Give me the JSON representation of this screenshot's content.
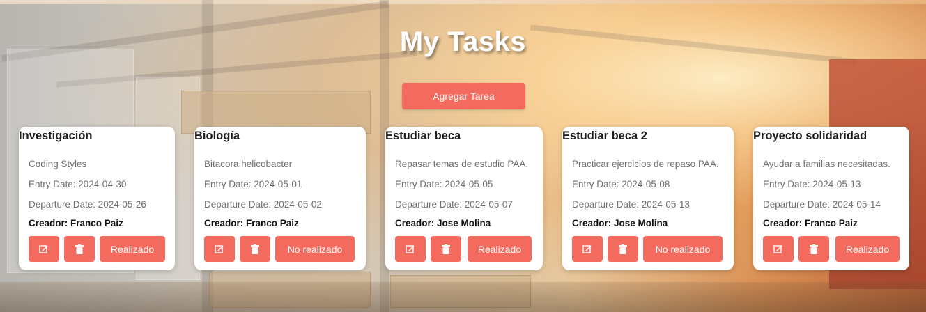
{
  "page": {
    "title": "My Tasks",
    "add_button_label": "Agregar Tarea"
  },
  "colors": {
    "accent": "#f36a5e",
    "card_bg": "#ffffff",
    "title_text": "#ffffff"
  },
  "icons": {
    "edit": "edit-icon",
    "delete": "trash-icon"
  },
  "tasks": [
    {
      "title": "Investigación",
      "description": "Coding Styles",
      "entry": "Entry Date: 2024-04-30",
      "departure": "Departure Date: 2024-05-26",
      "creator": "Creador: Franco Paiz",
      "status_label": "Realizado"
    },
    {
      "title": "Biología",
      "description": "Bitacora helicobacter",
      "entry": "Entry Date: 2024-05-01",
      "departure": "Departure Date: 2024-05-02",
      "creator": "Creador: Franco Paiz",
      "status_label": "No realizado"
    },
    {
      "title": "Estudiar beca",
      "description": "Repasar temas de estudio PAA.",
      "entry": "Entry Date: 2024-05-05",
      "departure": "Departure Date: 2024-05-07",
      "creator": "Creador: Jose Molina",
      "status_label": "Realizado"
    },
    {
      "title": "Estudiar beca 2",
      "description": "Practicar ejercicios de repaso PAA.",
      "entry": "Entry Date: 2024-05-08",
      "departure": "Departure Date: 2024-05-13",
      "creator": "Creador: Jose Molina",
      "status_label": "No realizado"
    },
    {
      "title": "Proyecto solidaridad",
      "description": "Ayudar a familias necesitadas.",
      "entry": "Entry Date: 2024-05-13",
      "departure": "Departure Date: 2024-05-14",
      "creator": "Creador: Franco Paiz",
      "status_label": "Realizado"
    }
  ]
}
